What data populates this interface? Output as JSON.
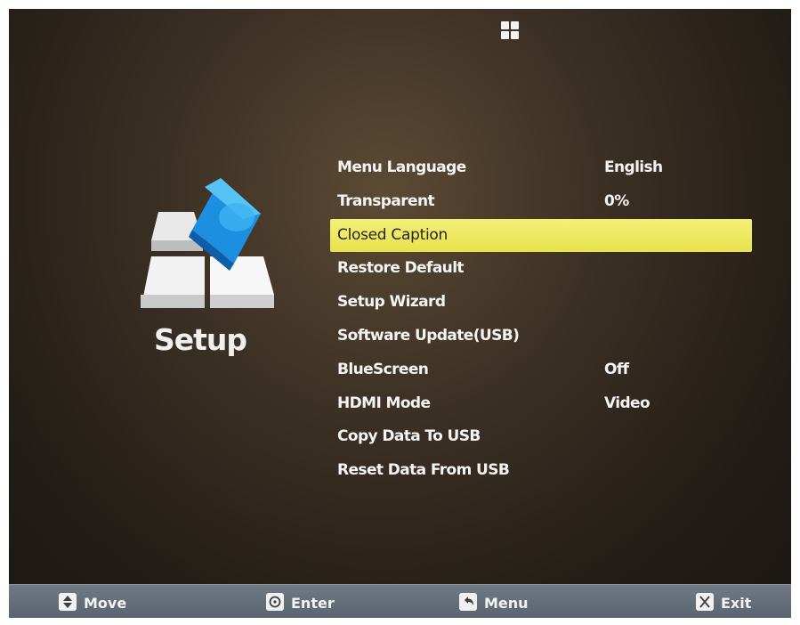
{
  "setup_panel": {
    "title": "Setup",
    "icon": "setup-cube-icon"
  },
  "top_bar": {
    "icon": "grid-icon"
  },
  "menu": {
    "items": [
      {
        "label": "Menu Language",
        "value": "English"
      },
      {
        "label": "Transparent",
        "value": "0%"
      },
      {
        "label": "Closed Caption",
        "value": ""
      },
      {
        "label": "Restore Default",
        "value": ""
      },
      {
        "label": "Setup Wizard",
        "value": ""
      },
      {
        "label": "Software Update(USB)",
        "value": ""
      },
      {
        "label": "BlueScreen",
        "value": "Off"
      },
      {
        "label": "HDMI Mode",
        "value": "Video"
      },
      {
        "label": "Copy Data To USB",
        "value": ""
      },
      {
        "label": "Reset Data From USB",
        "value": ""
      }
    ],
    "selected_index": 2
  },
  "footer": {
    "move": {
      "label": "Move",
      "icon": "up-down-arrow-icon"
    },
    "enter": {
      "label": "Enter",
      "icon": "ok-circle-icon"
    },
    "menu": {
      "label": "Menu",
      "icon": "return-arrow-icon"
    },
    "exit": {
      "label": "Exit",
      "icon": "exit-key-icon"
    }
  },
  "colors": {
    "highlight": "#f0ea60",
    "background": "#2e261d",
    "footer": "#66717b",
    "text": "#f4f4f4"
  }
}
